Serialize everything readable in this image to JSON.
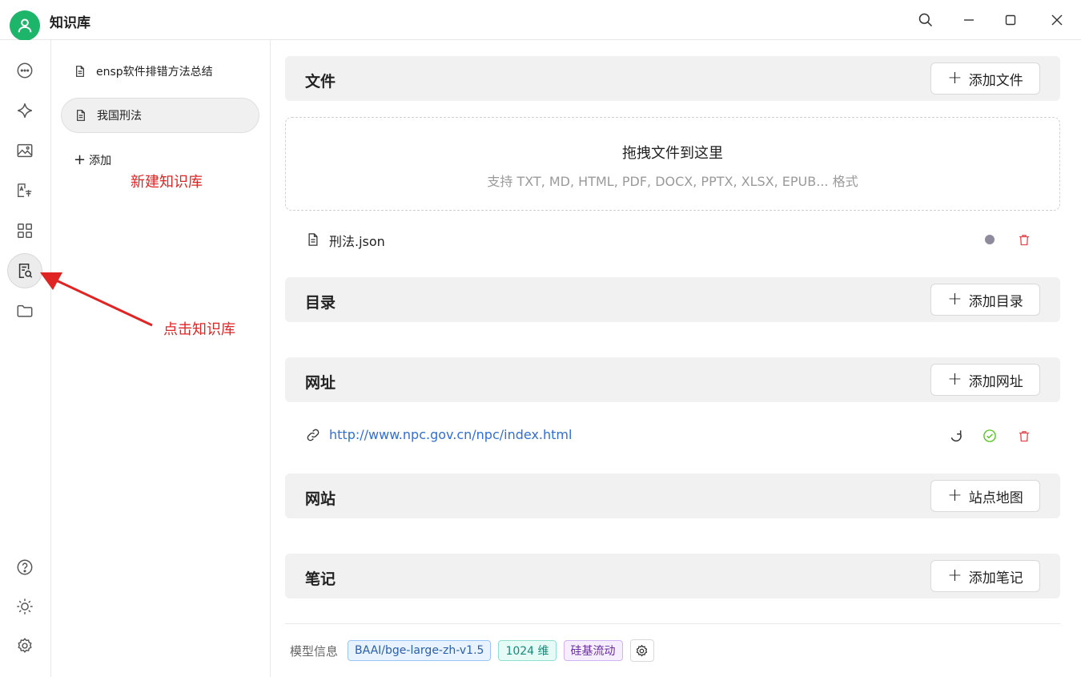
{
  "app": {
    "title": "知识库"
  },
  "window_controls": [
    "search-icon",
    "minimize-icon",
    "maximize-icon",
    "close-icon"
  ],
  "rail": {
    "items": [
      {
        "name": "chat",
        "icon": "chat-bubble-icon"
      },
      {
        "name": "agents",
        "icon": "sparkle-icon"
      },
      {
        "name": "images",
        "icon": "image-icon"
      },
      {
        "name": "translate",
        "icon": "translate-icon"
      },
      {
        "name": "apps",
        "icon": "grid-icon"
      },
      {
        "name": "knowledge",
        "icon": "knowledge-base-icon",
        "active": true
      },
      {
        "name": "files",
        "icon": "folder-icon"
      }
    ],
    "bottom_items": [
      {
        "name": "help",
        "icon": "help-icon"
      },
      {
        "name": "theme",
        "icon": "sun-icon"
      },
      {
        "name": "settings",
        "icon": "gear-icon"
      }
    ]
  },
  "kb_list": {
    "items": [
      {
        "label": "ensp软件排错方法总结"
      },
      {
        "label": "我国刑法",
        "active": true
      }
    ],
    "add_label": "添加"
  },
  "annotations": {
    "new_kb": "新建知识库",
    "click_kb": "点击知识库"
  },
  "sections": {
    "files": {
      "title": "文件",
      "button": "添加文件"
    },
    "dirs": {
      "title": "目录",
      "button": "添加目录"
    },
    "urls": {
      "title": "网址",
      "button": "添加网址"
    },
    "sites": {
      "title": "网站",
      "button": "站点地图"
    },
    "notes": {
      "title": "笔记",
      "button": "添加笔记"
    }
  },
  "dropzone": {
    "title": "拖拽文件到这里",
    "subtitle": "支持 TXT, MD, HTML, PDF, DOCX, PPTX, XLSX, EPUB... 格式"
  },
  "file_items": [
    {
      "name": "刑法.json"
    }
  ],
  "url_items": [
    {
      "url": "http://www.npc.gov.cn/npc/index.html"
    }
  ],
  "footer": {
    "label": "模型信息",
    "model": "BAAI/bge-large-zh-v1.5",
    "dims": "1024 维",
    "provider": "硅基流动"
  },
  "colors": {
    "accent_green": "#1db56a",
    "annotation_red": "#e02424",
    "link_blue": "#2f6fd8",
    "delete_red": "#e5484d",
    "ok_green": "#52c41a"
  }
}
